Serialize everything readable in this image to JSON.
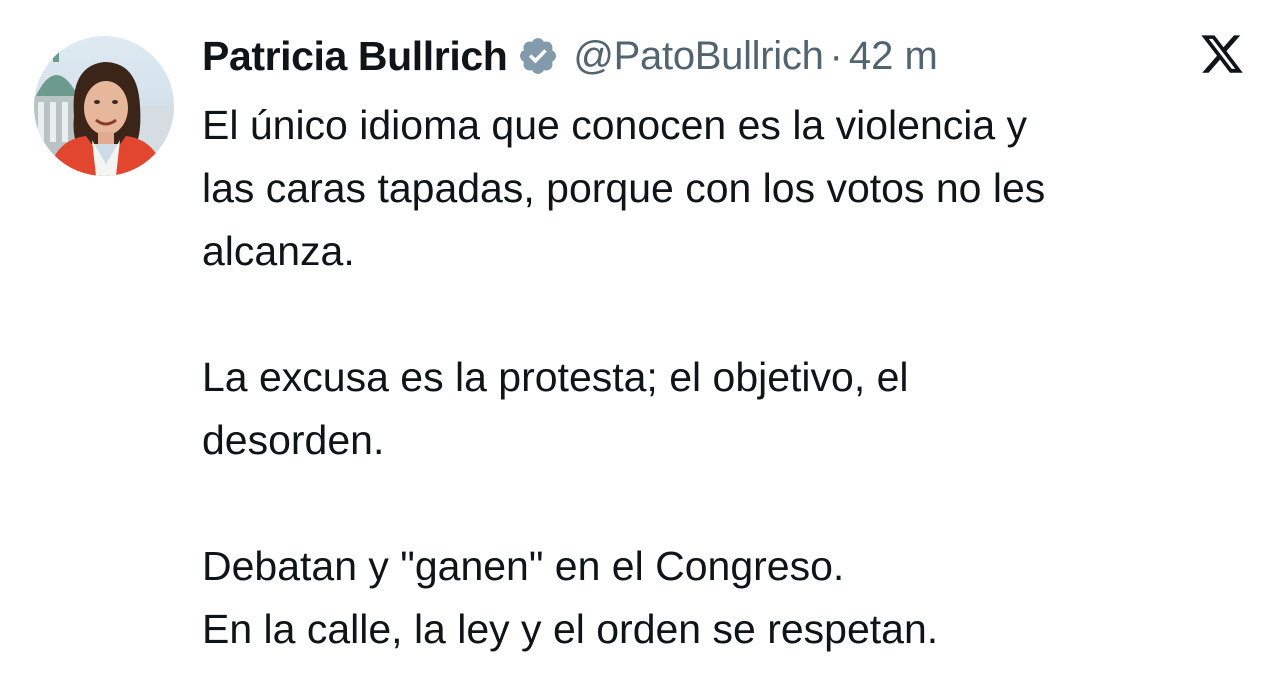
{
  "tweet": {
    "author": {
      "display_name": "Patricia Bullrich",
      "handle": "@PatoBullrich",
      "verified": true,
      "avatar_icon": "profile-photo"
    },
    "separator": "·",
    "timestamp": "42 m",
    "platform_icon": "x-logo-icon",
    "paragraphs": [
      {
        "lines": [
          "El único idioma que conocen es la violencia y",
          "las caras tapadas, porque con los votos no les",
          "alcanza."
        ]
      },
      {
        "lines": [
          "La excusa es la protesta; el objetivo, el",
          "desorden."
        ]
      },
      {
        "lines": [
          "Debatan y \"ganen\" en el Congreso.",
          "En la calle, la ley y el orden se respetan."
        ]
      }
    ]
  },
  "colors": {
    "text_primary": "#0f1419",
    "text_secondary": "#536471",
    "verified_badge": "#829aab",
    "background": "#ffffff"
  }
}
